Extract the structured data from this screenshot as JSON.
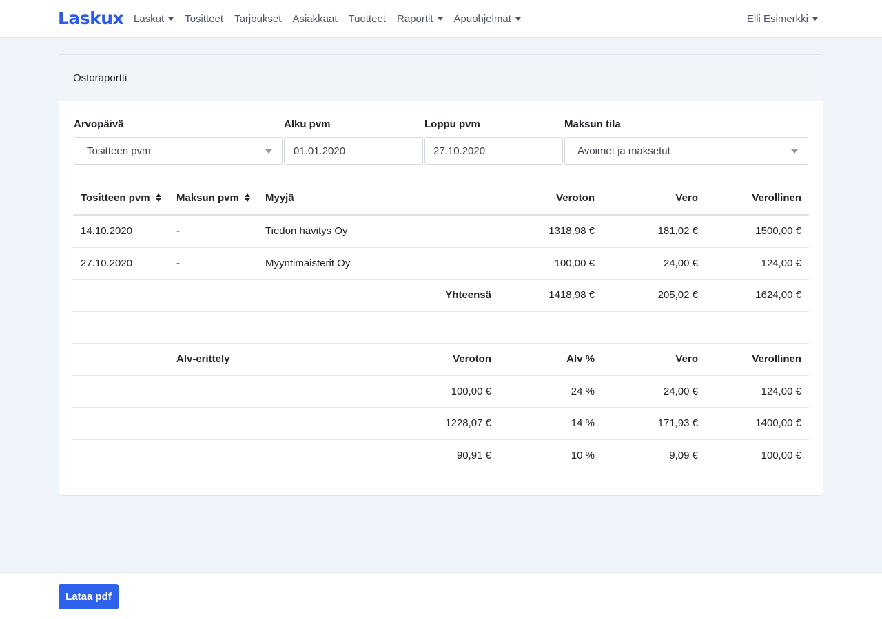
{
  "app": {
    "logo": "Laskux"
  },
  "nav": {
    "items": [
      {
        "label": "Laskut",
        "dropdown": true
      },
      {
        "label": "Tositteet",
        "dropdown": false
      },
      {
        "label": "Tarjoukset",
        "dropdown": false
      },
      {
        "label": "Asiakkaat",
        "dropdown": false
      },
      {
        "label": "Tuotteet",
        "dropdown": false
      },
      {
        "label": "Raportit",
        "dropdown": true
      },
      {
        "label": "Apuohjelmat",
        "dropdown": true
      }
    ],
    "user": "Elli Esimerkki"
  },
  "card": {
    "title": "Ostoraportti"
  },
  "filters": {
    "value_date": {
      "label": "Arvopäivä",
      "value": "Tositteen pvm"
    },
    "start_date": {
      "label": "Alku pvm",
      "value": "01.01.2020"
    },
    "end_date": {
      "label": "Loppu pvm",
      "value": "27.10.2020"
    },
    "payment_status": {
      "label": "Maksun tila",
      "value": "Avoimet ja maksetut"
    }
  },
  "purchases": {
    "headers": {
      "voucher_date": "Tositteen pvm",
      "payment_date": "Maksun pvm",
      "seller": "Myyjä",
      "net": "Veroton",
      "tax": "Vero",
      "gross": "Verollinen"
    },
    "rows": [
      {
        "voucher_date": "14.10.2020",
        "payment_date": "-",
        "seller": "Tiedon hävitys Oy",
        "net": "1318,98 €",
        "tax": "181,02 €",
        "gross": "1500,00 €"
      },
      {
        "voucher_date": "27.10.2020",
        "payment_date": "-",
        "seller": "Myyntimaisterit Oy",
        "net": "100,00 €",
        "tax": "24,00 €",
        "gross": "124,00 €"
      }
    ],
    "total": {
      "label": "Yhteensä",
      "net": "1418,98 €",
      "tax": "205,02 €",
      "gross": "1624,00 €"
    }
  },
  "vat_breakdown": {
    "headers": {
      "title": "Alv-erittely",
      "net": "Veroton",
      "rate": "Alv %",
      "tax": "Vero",
      "gross": "Verollinen"
    },
    "rows": [
      {
        "net": "100,00 €",
        "rate": "24 %",
        "tax": "24,00 €",
        "gross": "124,00 €"
      },
      {
        "net": "1228,07 €",
        "rate": "14 %",
        "tax": "171,93 €",
        "gross": "1400,00 €"
      },
      {
        "net": "90,91 €",
        "rate": "10 %",
        "tax": "9,09 €",
        "gross": "100,00 €"
      }
    ]
  },
  "footer": {
    "download_label": "Lataa pdf"
  },
  "colors": {
    "brand": "#2f5bea",
    "button": "#2f62ec",
    "background": "#eff4fb"
  }
}
